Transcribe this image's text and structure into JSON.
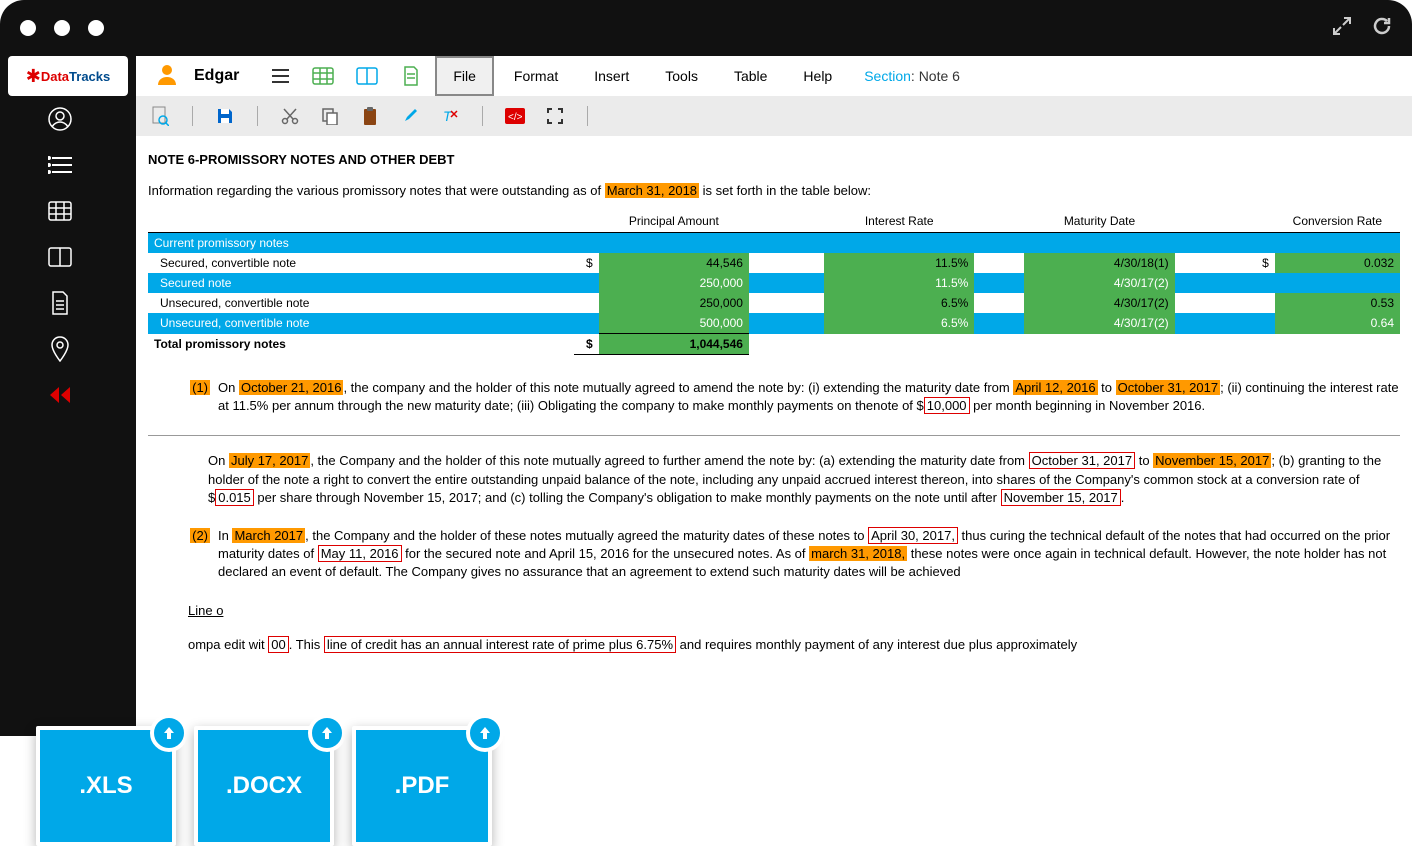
{
  "brand": {
    "name": "Edgar",
    "logo_data": "Data",
    "logo_tracks": "Tracks"
  },
  "menu": {
    "file": "File",
    "format": "Format",
    "insert": "Insert",
    "tools": "Tools",
    "table": "Table",
    "help": "Help",
    "section_prefix": "Section",
    "section_value": ": Note 6"
  },
  "doc": {
    "title": "NOTE 6-PROMISSORY NOTES AND OTHER DEBT",
    "intro_pre": "Information regarding the various promissory notes that were outstanding as of ",
    "intro_date": "March 31, 2018",
    "intro_post": " is set forth in the table below:"
  },
  "table": {
    "headers": {
      "principal": "Principal Amount",
      "interest": "Interest Rate",
      "maturity": "Maturity Date",
      "conversion": "Conversion Rate"
    },
    "section_current": "Current promissory notes",
    "rows": [
      {
        "label": "Secured, convertible note",
        "currency": "$",
        "principal": "44,546",
        "interest": "11.5%",
        "maturity": "4/30/18(1)",
        "ccurrency": "$",
        "conversion": "0.032",
        "blue": false
      },
      {
        "label": "Secured note",
        "currency": "",
        "principal": "250,000",
        "interest": "11.5%",
        "maturity": "4/30/17(2)",
        "ccurrency": "",
        "conversion": "",
        "blue": true
      },
      {
        "label": "Unsecured, convertible note",
        "currency": "",
        "principal": "250,000",
        "interest": "6.5%",
        "maturity": "4/30/17(2)",
        "ccurrency": "",
        "conversion": "0.53",
        "blue": false
      },
      {
        "label": "Unsecured, convertible note",
        "currency": "",
        "principal": "500,000",
        "interest": "6.5%",
        "maturity": "4/30/17(2)",
        "ccurrency": "",
        "conversion": "0.64",
        "blue": true
      }
    ],
    "total_label": "Total promissory notes",
    "total_currency": "$",
    "total_value": "1,044,546"
  },
  "notes": {
    "n1": {
      "num": "(1)",
      "a": "On ",
      "b": "October 21, 2016",
      "c": ", the company and the holder of this note mutually agreed to amend the note by: (i) extending the maturity date from ",
      "d": "April 12, 2016",
      "e": " to ",
      "f": "October 31, 2017",
      "g": "; (ii) continuing the interest rate at 11.5% per annum through the  new maturity date; (iii) Obligating the company to make monthly payments on thenote of $",
      "h": "10,000",
      "i": " per month beginning in November 2016."
    },
    "p2": {
      "a": "On ",
      "b": "July 17, 2017",
      "c": ", the Company and the holder of this note mutually agreed to further amend the note by: (a) extending the maturity date from ",
      "d": "October 31, 2017",
      "e": " to ",
      "f": "November 15, 2017",
      "g": "; (b) granting to the holder of the note a right to convert the entire outstanding unpaid balance of the note, including any unpaid accrued interest thereon, into shares of the Company's common stock at a conversion rate of $",
      "h": "0.015",
      "i": " per share through November 15, 2017; and (c) tolling the Company's obligation to make monthly payments on the note until after ",
      "j": "November 15, 2017",
      "k": "."
    },
    "n2": {
      "num": "(2)",
      "a": "In ",
      "b": "March 2017",
      "c": ", the Company and the holder of these notes mutually agreed the maturity dates of these notes to ",
      "d": "April 30, 2017,",
      "e": " thus curing the technical default of the notes that had occurred on the prior maturity dates of ",
      "f": "May 11, 2016",
      "g": " for the secured note and April 15, 2016 for the unsecured notes. As of ",
      "h": "march 31, 2018,",
      "i": " these notes were once again in technical default. However, the note holder has not declared an event of default. The Company gives no assurance that an agreement to extend such maturity dates will be achieved"
    },
    "loc_title": "Line o",
    "loc": {
      "a": "ompa",
      "b": "edit wit",
      "c": "00",
      "d": ". This ",
      "e": "line of credit has an annual interest rate of prime plus 6.75%",
      "f": " and requires monthly payment of any interest due plus approximately"
    }
  },
  "uploads": {
    "xls": ".XLS",
    "docx": ".DOCX",
    "pdf": ".PDF"
  }
}
